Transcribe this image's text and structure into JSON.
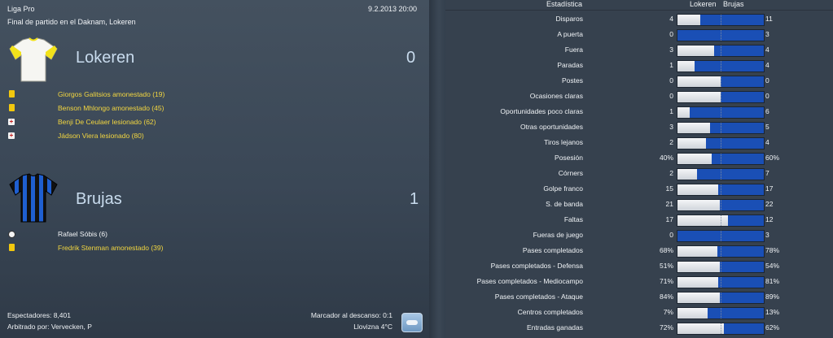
{
  "header": {
    "league": "Liga Pro",
    "datetime": "9.2.2013 20:00",
    "venue": "Final de partido en el Daknam, Lokeren"
  },
  "home": {
    "name": "Lokeren",
    "score": "0",
    "events": [
      {
        "type": "yellow-card",
        "text": "Giorgos Galitsios amonestado (19)"
      },
      {
        "type": "yellow-card",
        "text": "Benson Mhlongo amonestado (45)"
      },
      {
        "type": "injury",
        "text": "Benji De Ceulaer lesionado (62)"
      },
      {
        "type": "injury",
        "text": "Jádson Viera lesionado (80)"
      }
    ]
  },
  "away": {
    "name": "Brujas",
    "score": "1",
    "events": [
      {
        "type": "goal",
        "text": "Rafael Sóbis (6)"
      },
      {
        "type": "yellow-card",
        "text": "Fredrik Stenman amonestado (39)"
      }
    ]
  },
  "footer": {
    "spectators": "Espectadores: 8,401",
    "referee": "Arbitrado por: Vervecken, P",
    "halftime": "Marcador al descanso: 0:1",
    "weather": "Llovizna 4°C"
  },
  "stats": {
    "col_stat": "Estadística",
    "col_home": "Lokeren",
    "col_away": "Brujas",
    "rows": [
      {
        "label": "Disparos",
        "home": "4",
        "away": "11",
        "home_share": 0.267
      },
      {
        "label": "A puerta",
        "home": "0",
        "away": "3",
        "home_share": 0.0
      },
      {
        "label": "Fuera",
        "home": "3",
        "away": "4",
        "home_share": 0.429
      },
      {
        "label": "Paradas",
        "home": "1",
        "away": "4",
        "home_share": 0.2
      },
      {
        "label": "Postes",
        "home": "0",
        "away": "0",
        "home_share": 0.5
      },
      {
        "label": "Ocasiones claras",
        "home": "0",
        "away": "0",
        "home_share": 0.5
      },
      {
        "label": "Oportunidades poco claras",
        "home": "1",
        "away": "6",
        "home_share": 0.143
      },
      {
        "label": "Otras oportunidades",
        "home": "3",
        "away": "5",
        "home_share": 0.375
      },
      {
        "label": "Tiros lejanos",
        "home": "2",
        "away": "4",
        "home_share": 0.333
      },
      {
        "label": "Posesión",
        "home": "40%",
        "away": "60%",
        "home_share": 0.4
      },
      {
        "label": "Córners",
        "home": "2",
        "away": "7",
        "home_share": 0.222
      },
      {
        "label": "Golpe franco",
        "home": "15",
        "away": "17",
        "home_share": 0.469
      },
      {
        "label": "S. de banda",
        "home": "21",
        "away": "22",
        "home_share": 0.488
      },
      {
        "label": "Faltas",
        "home": "17",
        "away": "12",
        "home_share": 0.586
      },
      {
        "label": "Fueras de juego",
        "home": "0",
        "away": "3",
        "home_share": 0.0
      },
      {
        "label": "Pases completados",
        "home": "68%",
        "away": "78%",
        "home_share": 0.466
      },
      {
        "label": "Pases completados - Defensa",
        "home": "51%",
        "away": "54%",
        "home_share": 0.486
      },
      {
        "label": "Pases completados - Mediocampo",
        "home": "71%",
        "away": "81%",
        "home_share": 0.467
      },
      {
        "label": "Pases completados - Ataque",
        "home": "84%",
        "away": "89%",
        "home_share": 0.486
      },
      {
        "label": "Centros completados",
        "home": "7%",
        "away": "13%",
        "home_share": 0.35
      },
      {
        "label": "Entradas ganadas",
        "home": "72%",
        "away": "62%",
        "home_share": 0.537
      }
    ]
  },
  "colors": {
    "home_bar": "#f4f5f7",
    "away_bar": "#1a4fb5",
    "card": "#f2c80e",
    "event_text": "#f2d640"
  }
}
